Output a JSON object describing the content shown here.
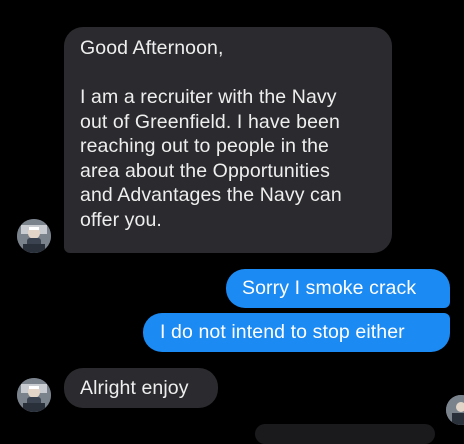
{
  "messages": [
    {
      "direction": "incoming",
      "lines": [
        "Good Afternoon,",
        "I am a recruiter with the Navy",
        "out of Greenfield. I have been",
        "reaching out to people in the",
        "area about the Opportunities",
        "and Advantages the Navy can",
        "offer you."
      ]
    },
    {
      "direction": "outgoing",
      "text": "Sorry I smoke crack"
    },
    {
      "direction": "outgoing",
      "text": "I do not intend to stop either"
    },
    {
      "direction": "incoming",
      "text": "Alright enjoy"
    }
  ],
  "colors": {
    "background": "#000000",
    "incoming_bubble": "#2b2b2f",
    "outgoing_bubble": "#1b8af3",
    "incoming_text": "#eeeeee",
    "outgoing_text": "#ffffff"
  },
  "icons": {
    "sender_avatar": "avatar",
    "read_receipt_avatar": "avatar"
  }
}
